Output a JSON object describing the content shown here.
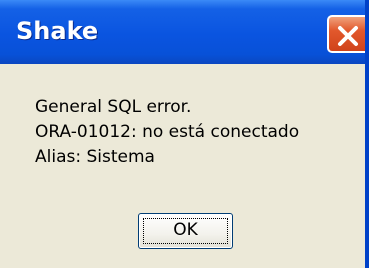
{
  "window": {
    "title": "Shake"
  },
  "message": {
    "lines": [
      "General SQL error.",
      "ORA-01012: no está conectado",
      "Alias: Sistema"
    ]
  },
  "buttons": {
    "ok_label": "OK"
  },
  "icons": {
    "close": "close-icon"
  },
  "colors": {
    "titlebar": "#0A54E0",
    "dialog_background": "#ECE9D8",
    "close_button": "#E2582C"
  }
}
